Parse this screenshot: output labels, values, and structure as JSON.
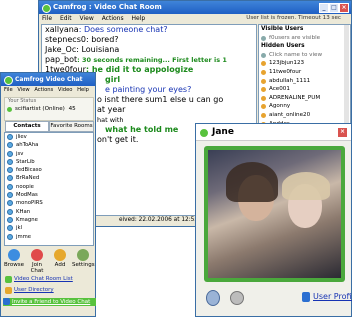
{
  "main_window": {
    "title": "Camfrog : Video Chat Room",
    "menu": [
      "File",
      "Edit",
      "View",
      "Actions",
      "Help"
    ],
    "status_text": "User list is frozen. Timeout 13 sec",
    "chat_lines": [
      {
        "nick": "xallyana",
        "text": ": Does someone chat?",
        "style": "blue"
      },
      {
        "nick": "stepnecs0",
        "text": ": bored?",
        "style": "normal"
      },
      {
        "nick": "Jake_Oc",
        "text": ": Louisiana",
        "style": "normal"
      },
      {
        "nick": "pap_bot",
        "text": ": 30 seconds remaining... First letter is 1",
        "style": "green-small"
      },
      {
        "nick": "1twe0four",
        "text": ": he did it to appologize",
        "style": "green"
      },
      {
        "nick": "",
        "text": "girl",
        "style": "green"
      },
      {
        "nick": "",
        "text": "e painting your eyes?",
        "style": "blue"
      },
      {
        "nick": "",
        "text": "o isnt there sum1 else u can go",
        "style": "normal"
      },
      {
        "nick": "",
        "text": "",
        "style": "normal"
      },
      {
        "nick": "",
        "text": "",
        "style": "normal"
      },
      {
        "nick": "",
        "text": "at year",
        "style": "normal"
      },
      {
        "nick": "",
        "text": "hat with",
        "style": "small"
      },
      {
        "nick": "",
        "text": "what he told me",
        "style": "green"
      },
      {
        "nick": "",
        "text": "on't get it.",
        "style": "normal"
      }
    ],
    "received_text": "eived: 22.02.2006 at 12:55:15.",
    "visible_users_header": "Visible Users",
    "visible_users": [
      "f0users are visible"
    ],
    "hidden_users_header": "Hidden Users",
    "hidden_users": [
      "Click name to view",
      "123jbjun123",
      "11twe0four",
      "abdullah_1111",
      "Ace001",
      "ADRENALINE_PUM",
      "Agonny",
      "aiant_online20",
      "Anddes",
      "anotha_one",
      "aone250h"
    ]
  },
  "sidebar_window": {
    "title": "Camfrog Video Chat",
    "menu": [
      "File",
      "View",
      "Actions",
      "Video",
      "Help"
    ],
    "status_label": "Your Status",
    "username": "scifiartist (Online)",
    "user_count": "45",
    "tabs": [
      "Contacts",
      "Favorite Rooms"
    ],
    "rooms": [
      "jliev",
      "ahToAha",
      "jsv",
      "StarLib",
      "fedBicaso",
      "BrRaNed",
      "noopie",
      "ModMas",
      "monoPIRS",
      "KHan",
      "Kmagne",
      "jkl",
      "jmme"
    ],
    "buttons": [
      "Browse",
      "Join Chat",
      "Add",
      "Settings"
    ],
    "links": [
      "Video Chat Room List",
      "User Directory",
      "Invite a Friend to Video Chat"
    ]
  },
  "video_window": {
    "title": "Jane",
    "profile_link": "User Profile"
  }
}
